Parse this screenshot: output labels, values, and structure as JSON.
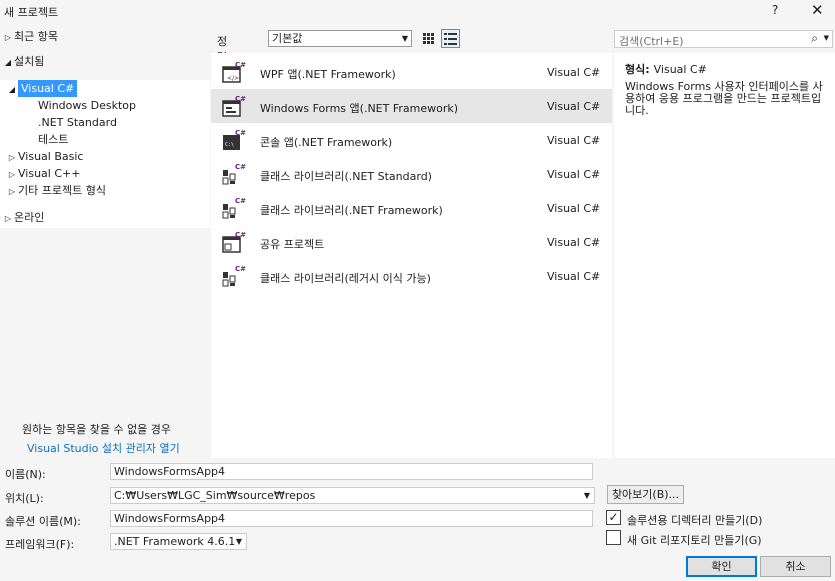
{
  "window": {
    "title": "새 프로젝트",
    "help": "?",
    "close": "✕"
  },
  "tree": {
    "recent": "최근 항목",
    "installed": "설치됨",
    "visual_csharp": "Visual C#",
    "windows_desktop": "Windows Desktop",
    "net_standard": ".NET Standard",
    "test": "테스트",
    "visual_basic": "Visual Basic",
    "visual_cpp": "Visual C++",
    "other_types": "기타 프로젝트 형식",
    "online": "온라인",
    "hint": "원하는 항목을 찾을 수 없을 경우",
    "hint_link": "Visual Studio 설치 관리자 열기"
  },
  "sort": {
    "label": "정렬 기준:",
    "value": "기본값"
  },
  "search": {
    "placeholder": "검색(Ctrl+E)"
  },
  "templates": [
    {
      "name": "WPF 앱(.NET Framework)",
      "lang": "Visual C#",
      "icon": "wpf-app-icon"
    },
    {
      "name": "Windows Forms 앱(.NET Framework)",
      "lang": "Visual C#",
      "icon": "winforms-app-icon"
    },
    {
      "name": "콘솔 앱(.NET Framework)",
      "lang": "Visual C#",
      "icon": "console-app-icon"
    },
    {
      "name": "클래스 라이브러리(.NET Standard)",
      "lang": "Visual C#",
      "icon": "class-library-icon"
    },
    {
      "name": "클래스 라이브러리(.NET Framework)",
      "lang": "Visual C#",
      "icon": "class-library-icon"
    },
    {
      "name": "공유 프로젝트",
      "lang": "Visual C#",
      "icon": "shared-project-icon"
    },
    {
      "name": "클래스 라이브러리(레거시 이식 가능)",
      "lang": "Visual C#",
      "icon": "class-library-icon"
    }
  ],
  "description": {
    "type_label": "형식:",
    "type_value": "Visual C#",
    "text": "Windows Forms 사용자 인터페이스를 사용하여 응용 프로그램을 만드는 프로젝트입니다."
  },
  "form": {
    "name_label": "이름(N):",
    "name_value": "WindowsFormsApp4",
    "location_label": "위치(L):",
    "location_value": "C:₩Users₩LGC_Sim₩source₩repos",
    "browse": "찾아보기(B)...",
    "solution_label": "솔루션 이름(M):",
    "solution_value": "WindowsFormsApp4",
    "framework_label": "프레임워크(F):",
    "framework_value": ".NET Framework 4.6.1",
    "create_dir": "솔루션용 디렉터리 만들기(D)",
    "create_git": "새 Git 리포지토리 만들기(G)",
    "ok": "확인",
    "cancel": "취소"
  },
  "colors": {
    "selection": "#3399ff",
    "link": "#0e70c0",
    "csharp_badge": "#68217a"
  }
}
